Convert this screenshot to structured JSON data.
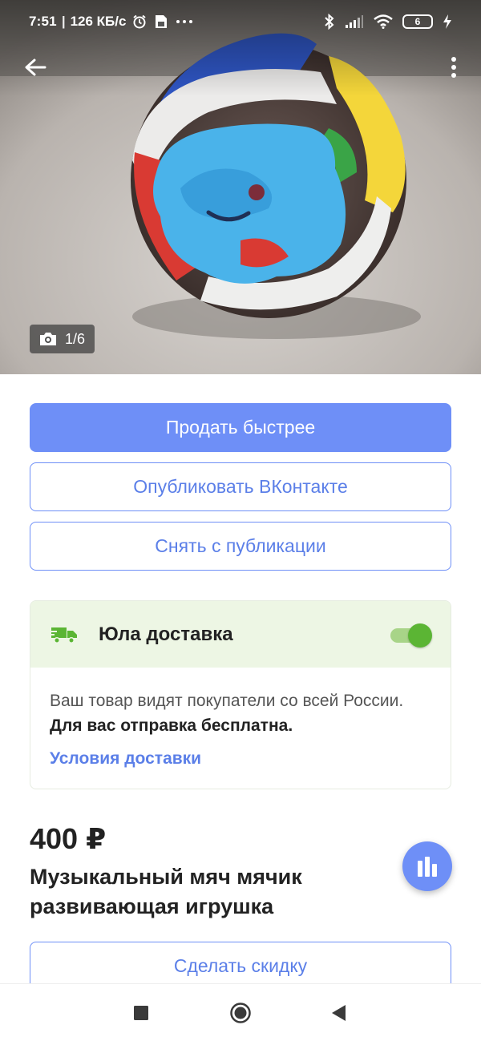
{
  "status_bar": {
    "time": "7:51",
    "network_speed": "126 КБ/с",
    "battery": "6",
    "icons": [
      "alarm-icon",
      "save-icon",
      "more-dots-icon",
      "bluetooth-icon",
      "signal-icon",
      "wifi-icon",
      "battery-icon",
      "charging-icon"
    ]
  },
  "photo": {
    "counter": "1/6",
    "icon": "camera-icon"
  },
  "actions": {
    "sell_faster": "Продать быстрее",
    "publish_vk": "Опубликовать ВКонтакте",
    "unpublish": "Снять с публикации",
    "make_discount": "Сделать скидку"
  },
  "delivery": {
    "title": "Юла доставка",
    "enabled": true,
    "description": "Ваш товар видят покупатели со всей России.",
    "free_note": "Для вас отправка бесплатна.",
    "conditions_link": "Условия доставки",
    "accent_color": "#5bb534"
  },
  "listing": {
    "price": "400 ₽",
    "title": "Музыкальный мяч мячик развивающая игрушка"
  },
  "colors": {
    "primary": "#6e8ff7",
    "link": "#5b7fe8",
    "delivery_header_bg": "#edf6e4"
  }
}
